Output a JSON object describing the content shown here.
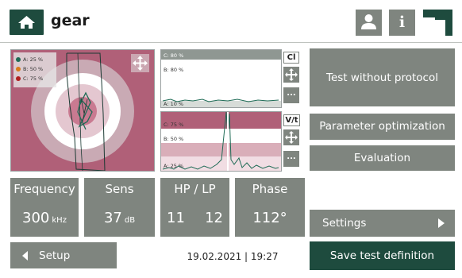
{
  "header": {
    "title": "gear",
    "home_icon": "home-icon",
    "user_icon": "user-icon",
    "info_label": "i",
    "logo_icon": "brand-logo"
  },
  "main_plot": {
    "legend": [
      {
        "label": "A: 25 %",
        "color": "#1e6b55"
      },
      {
        "label": "B: 50 %",
        "color": "#d97a1a"
      },
      {
        "label": "C: 75 %",
        "color": "#b01e1e"
      }
    ],
    "move_icon": "move-arrows-icon"
  },
  "cl_plot": {
    "tag": "Cl",
    "ticks": [
      "C: 80 %",
      "B: 80 %",
      "A: 10 %"
    ]
  },
  "vt_plot": {
    "tag": "V/t",
    "ticks": [
      "C: 75 %",
      "B: 50 %",
      "A: 25 %"
    ]
  },
  "buttons": {
    "test_without_protocol": "Test without protocol",
    "parameter_optimization": "Parameter optimization",
    "evaluation": "Evaluation",
    "settings": "Settings",
    "setup": "Setup",
    "save_test_definition": "Save test definition",
    "more": "..."
  },
  "tiles": {
    "frequency": {
      "label": "Frequency",
      "value": "300",
      "unit": "kHz"
    },
    "sens": {
      "label": "Sens",
      "value": "37",
      "unit": "dB"
    },
    "hp_lp": {
      "label": "HP / LP",
      "hp": "11",
      "lp": "12"
    },
    "phase": {
      "label": "Phase",
      "value": "112°"
    }
  },
  "status": {
    "date_time": "19.02.2021 | 19:27"
  },
  "colors": {
    "primary": "#1e4b3e",
    "button_gray": "#7f857f",
    "plot_bg": "#b06078"
  }
}
